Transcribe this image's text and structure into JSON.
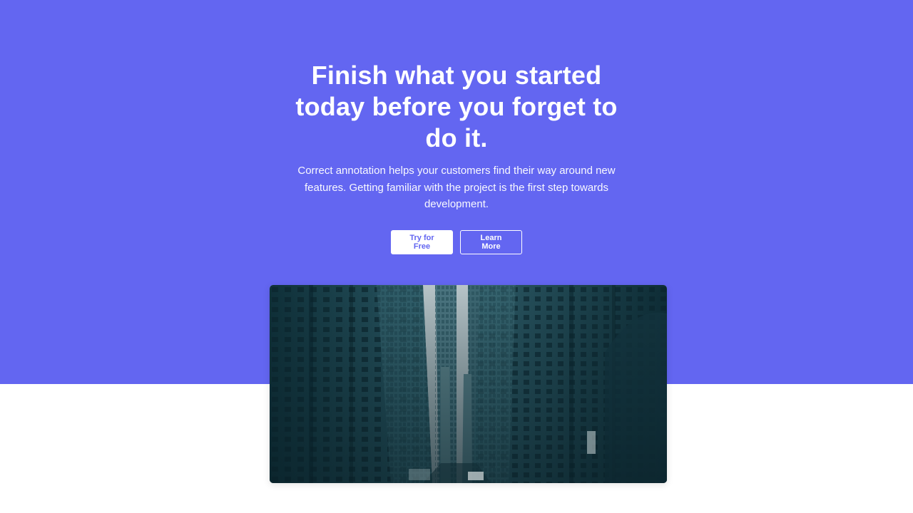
{
  "hero": {
    "title": "Finish what you started today before you forget to do it.",
    "subtitle": "Correct annotation helps your customers find their way around new features. Getting familiar with the project is the first step towards development.",
    "primary_button_label": "Try for Free",
    "secondary_button_label": "Learn More"
  },
  "colors": {
    "accent": "#6366f1",
    "background": "#ffffff",
    "text_on_accent": "#ffffff"
  },
  "image": {
    "subject": "city-street-skyscrapers-photo"
  }
}
